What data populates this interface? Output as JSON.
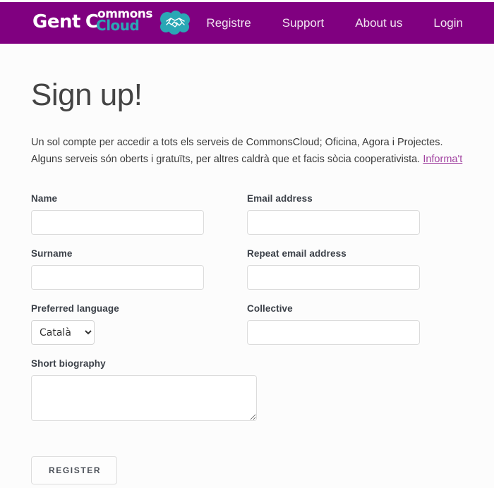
{
  "header": {
    "brand": {
      "gent": "Gent",
      "c": "C",
      "commons": "ommons",
      "cloud": "Cloud",
      "icon": "handshake-cloud-icon"
    },
    "nav": [
      {
        "label": "Registre"
      },
      {
        "label": "Support"
      },
      {
        "label": "About us"
      },
      {
        "label": "Login"
      }
    ],
    "background_color": "#800080"
  },
  "main": {
    "title": "Sign up!",
    "intro_line1": "Un sol compte per accedir a tots els serveis de CommonsCloud; Oficina, Agora i Projectes.",
    "intro_line2": "Alguns serveis són oberts i gratuïts, per altres caldrà que et facis sòcia cooperativista.",
    "intro_link": "Informa't",
    "link_color": "#a0409f"
  },
  "form": {
    "fields": {
      "name": {
        "label": "Name",
        "value": "",
        "placeholder": ""
      },
      "email": {
        "label": "Email address",
        "value": "",
        "placeholder": ""
      },
      "surname": {
        "label": "Surname",
        "value": "",
        "placeholder": ""
      },
      "repeat_email": {
        "label": "Repeat email address",
        "value": "",
        "placeholder": ""
      },
      "preferred_language": {
        "label": "Preferred language",
        "value": "Català",
        "options": [
          "Català"
        ]
      },
      "collective": {
        "label": "Collective",
        "value": "",
        "placeholder": ""
      },
      "short_biography": {
        "label": "Short biography",
        "value": "",
        "placeholder": ""
      }
    },
    "submit_label": "REGISTER"
  }
}
